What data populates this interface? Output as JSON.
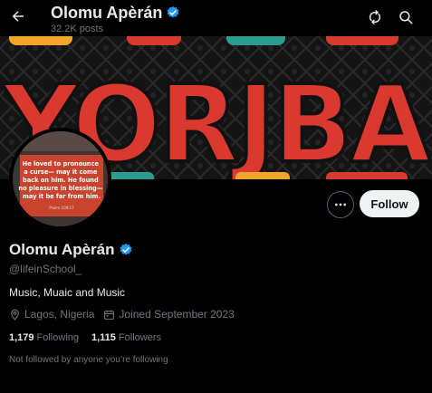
{
  "header": {
    "name": "Olomu Apèrán",
    "posts": "32.2K posts"
  },
  "banner": {
    "word": "YORJBA"
  },
  "avatar": {
    "quote_lines": [
      "He loved to pronounce",
      "a curse— may it come",
      "back on him. He found",
      "no pleasure in blessing—",
      "may it be far from him."
    ],
    "reference": "Psalm 109:17"
  },
  "actions": {
    "follow_label": "Follow"
  },
  "profile": {
    "display_name": "Olomu Apèrán",
    "handle": "@lifeinSchool_",
    "bio": "Music, Muaic and Music",
    "location": "Lagos, Nigeria",
    "joined": "Joined September 2023",
    "following_count": "1,179",
    "following_label": "Following",
    "followers_count": "1,115",
    "followers_label": "Followers",
    "not_followed": "Not followed by anyone you’re following"
  },
  "colors": {
    "verified": "#1d9bf0",
    "follow_bg": "#eff3f4",
    "muted": "#71767b",
    "text": "#e7e9ea"
  }
}
